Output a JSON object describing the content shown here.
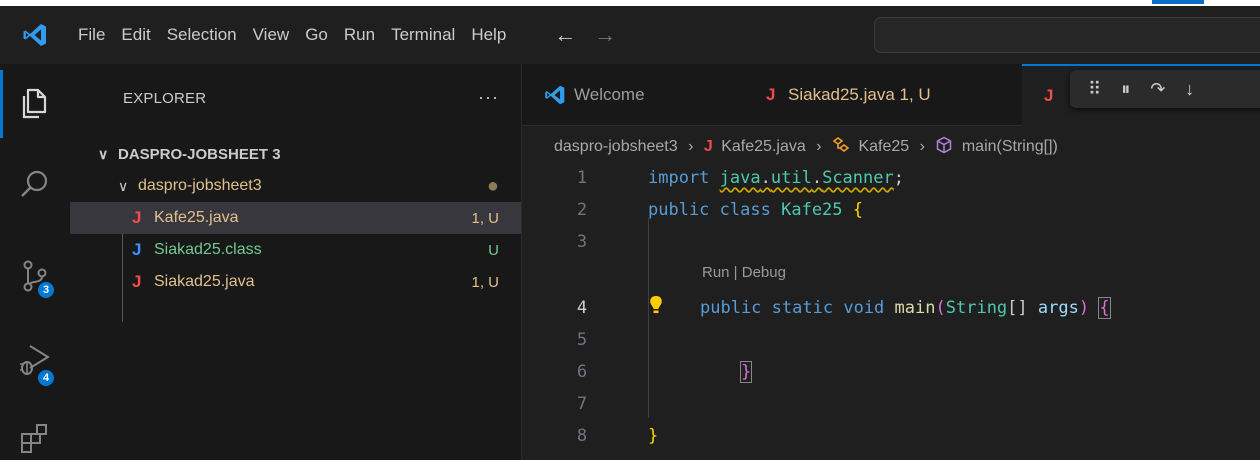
{
  "colors": {
    "accent": "#0078d4",
    "java_red": "#f14c4c",
    "java_blue": "#3794ff",
    "modified": "#e2c08d"
  },
  "menu": {
    "items": [
      "File",
      "Edit",
      "Selection",
      "View",
      "Go",
      "Run",
      "Terminal",
      "Help"
    ]
  },
  "activity": {
    "scm_badge": "3",
    "debug_badge": "4"
  },
  "explorer": {
    "header": "EXPLORER",
    "more": "···",
    "root": "DASPRO-JOBSHEET 3",
    "folder": "daspro-jobsheet3",
    "files": [
      {
        "name": "Kafe25.java",
        "status": "1, U",
        "icon": "java-red-icon"
      },
      {
        "name": "Siakad25.class",
        "status": "U",
        "icon": "java-blue-icon"
      },
      {
        "name": "Siakad25.java",
        "status": "1, U",
        "icon": "java-red-icon"
      }
    ]
  },
  "tabs": [
    {
      "label": "Welcome"
    },
    {
      "label": "Siakad25.java 1, U"
    }
  ],
  "breadcrumbs": {
    "folder": "daspro-jobsheet3",
    "file": "Kafe25.java",
    "class": "Kafe25",
    "method": "main(String[])"
  },
  "editor": {
    "line_numbers": [
      "1",
      "2",
      "3",
      "4",
      "5",
      "6",
      "7",
      "8"
    ],
    "codelens": "Run | Debug"
  }
}
